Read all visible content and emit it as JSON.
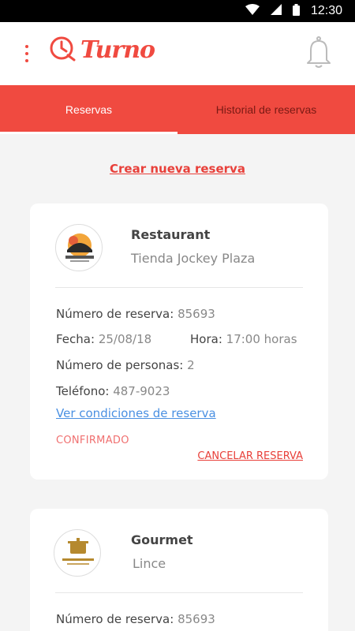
{
  "status_bar": {
    "time": "12:30",
    "icons": [
      "wifi-icon",
      "signal-icon",
      "battery-icon"
    ]
  },
  "app_bar": {
    "brand": "Turno",
    "menu_icon": "more-vert-icon",
    "notification_icon": "bell-icon"
  },
  "tabs": [
    {
      "label": "Reservas",
      "active": true
    },
    {
      "label": "Historial de reservas",
      "active": false
    }
  ],
  "create_link": "Crear nueva reserva",
  "reservations": [
    {
      "name": "Restaurant",
      "location": "Tienda Jockey Plaza",
      "logo_icon": "restaurant-logo",
      "number_label": "Número de reserva:",
      "number": "85693",
      "date_label": "Fecha:",
      "date": "25/08/18",
      "time_label": "Hora:",
      "time": "17:00 horas",
      "people_label": "Número de personas:",
      "people": "2",
      "phone_label": "Teléfono:",
      "phone": "487-9023",
      "conditions_link": "Ver condiciones de reserva",
      "status": "CONFIRMADO",
      "cancel": "CANCELAR RESERVA"
    },
    {
      "name": "Gourmet",
      "location": "Lince",
      "logo_icon": "gourmet-logo",
      "number_label": "Número de reserva:",
      "number": "85693"
    }
  ],
  "colors": {
    "primary": "#f04a40",
    "link": "#4a90e2",
    "status": "#f07070",
    "background": "#f4f4f4"
  }
}
